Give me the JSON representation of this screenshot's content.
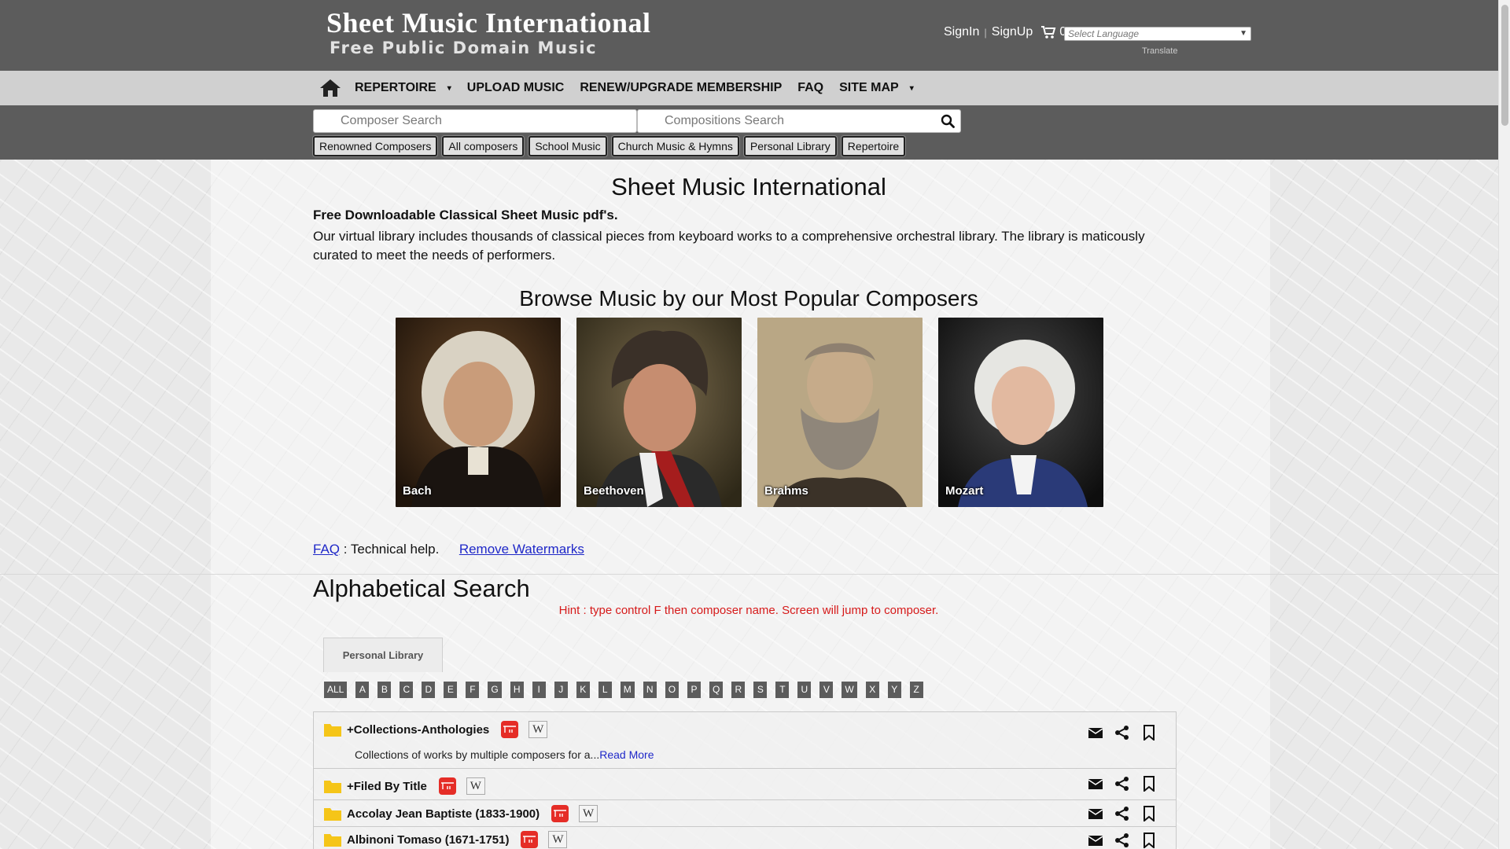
{
  "header": {
    "logo_title": "Sheet Music International",
    "logo_subtitle": "Free Public Domain Music",
    "signin": "SignIn",
    "separator": "|",
    "signup": "SignUp",
    "cart_count": "0",
    "cart_icon": "shopping-cart-icon",
    "language_placeholder": "Select Language",
    "translate": "Translate"
  },
  "nav": {
    "home_icon": "home-icon",
    "items": [
      {
        "label": "REPERTOIRE",
        "caret": "▾"
      },
      {
        "label": "UPLOAD MUSIC",
        "caret": ""
      },
      {
        "label": "RENEW/UPGRADE MEMBERSHIP",
        "caret": ""
      },
      {
        "label": "FAQ",
        "caret": ""
      },
      {
        "label": "SITE MAP",
        "caret": "▾"
      }
    ]
  },
  "search": {
    "composer_placeholder": "Composer Search",
    "compositions_placeholder": "Compositions Search",
    "search_icon": "search-icon"
  },
  "chips": [
    "Renowned Composers",
    "All composers",
    "School Music",
    "Church Music & Hymns",
    "Personal Library",
    "Repertoire"
  ],
  "main": {
    "title": "Sheet Music International",
    "subtitle": "Free Downloadable Classical Sheet Music pdf's.",
    "intro": "Our virtual library includes thousands of classical pieces from keyboard works to a comprehensive orchestral library.  The library is maticously curated to meet the needs of performers.",
    "browse_title": "Browse Music by our Most Popular Composers",
    "composers": [
      "Bach",
      "Beethoven",
      "Brahms",
      "Mozart"
    ]
  },
  "help": {
    "faq": "FAQ",
    "faq_suffix": ": Technical help.",
    "remove_watermarks": "Remove Watermarks"
  },
  "alpha": {
    "title": "Alphabetical Search",
    "hint": "Hint : type control F then composer name. Screen will jump to composer.",
    "tab": "Personal Library",
    "letters": [
      "ALL",
      "A",
      "B",
      "C",
      "D",
      "E",
      "F",
      "G",
      "H",
      "I",
      "J",
      "K",
      "L",
      "M",
      "N",
      "O",
      "P",
      "Q",
      "R",
      "S",
      "T",
      "U",
      "V",
      "W",
      "X",
      "Y",
      "Z"
    ]
  },
  "list": [
    {
      "title": "+Collections-Anthologies",
      "desc": "Collections of works by multiple composers for a...",
      "read_more": "Read More"
    },
    {
      "title": "+Filed By Title"
    },
    {
      "title": "Accolay Jean Baptiste (1833-1900)"
    },
    {
      "title": "Albinoni Tomaso (1671-1751)"
    }
  ],
  "icons": {
    "youtube": "youtube-icon",
    "wikipedia": "wikipedia-icon",
    "wikipedia_glyph": "W",
    "folder": "folder-icon",
    "email": "envelope-icon",
    "share": "share-icon",
    "bookmark": "bookmark-icon"
  },
  "colors": {
    "header_bg": "#5c5c5c",
    "nav_bg": "#d0d0d0",
    "link": "#1f28c8",
    "hint": "#d61a1a",
    "folder": "#f5c518",
    "youtube": "#e52d27"
  }
}
